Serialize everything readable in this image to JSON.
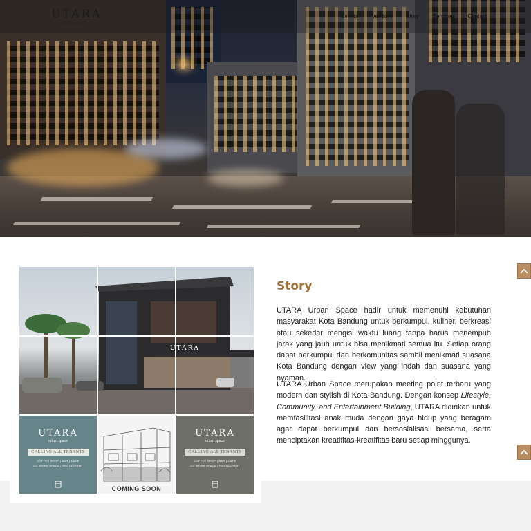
{
  "brand": {
    "name": "UTARA",
    "tagline": "urban space"
  },
  "nav": {
    "items": [
      "Events",
      "Vendors",
      "Story",
      "Services",
      "Contact"
    ]
  },
  "story": {
    "title": "Story",
    "paragraph1": "UTARA Urban Space hadir untuk memenuhi kebutuhan masyarakat Kota Bandung untuk berkumpul, kuliner, berkreasi atau sekedar mengisi waktu luang tanpa harus menempuh jarak yang jauh untuk bisa menikmati semua itu. Setiap orang dapat berkumpul dan berkomunitas sambil menikmati suasana Kota Bandung dengan view yang indah dan suasana yang nyaman.",
    "paragraph2_before": "UTARA Urban Space merupakan meeting point terbaru yang modern dan stylish di Kota Bandung. Dengan konsep ",
    "paragraph2_emphasis": "Lifestyle, Community, and Entertainment Building",
    "paragraph2_after": ", UTARA didirikan untuk memfasilitasi anak muda dengan gaya hidup yang beragam agar dapat berkumpul dan bersosialisasi bersama, serta menciptakan kreatifitas-kreatifitas baru setiap minggunya."
  },
  "gallery": {
    "building_sign": "UTARA",
    "poster_left": {
      "logo": "UTARA",
      "sub": "urban space",
      "banner": "CALLING ALL TENANTS",
      "line1": "COFFEE SHOP | BAR | CAFE",
      "line2": "CO WORK SPACE | RESTAURANT"
    },
    "poster_middle": {
      "caption": "COMING SOON"
    },
    "poster_right": {
      "logo": "UTARA",
      "sub": "urban space",
      "banner": "CALLING ALL TENANTS",
      "line1": "COFFEE SHOP | BAR | CAFE",
      "line2": "CO WORK SPACE | RESTAURANT"
    }
  },
  "icons": {
    "scroll_up": "chevron-up-icon"
  },
  "colors": {
    "accent": "#a0713b",
    "scroll_button": "#b98f63",
    "poster_teal": "#66858b",
    "poster_gray": "#6e7068"
  }
}
